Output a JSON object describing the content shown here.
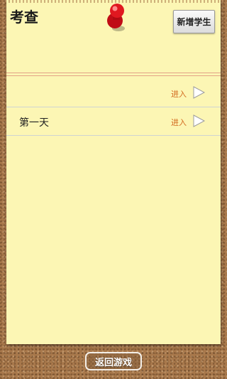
{
  "header": {
    "title": "考查",
    "add_student_label": "新增学生"
  },
  "list": {
    "rows": [
      {
        "label": "",
        "enter_label": "进入"
      },
      {
        "label": "第一天",
        "enter_label": "进入"
      }
    ]
  },
  "footer": {
    "back_label": "返回游戏"
  },
  "icons": {
    "pin": "push-pin-icon",
    "arrow": "play-arrow-icon"
  },
  "colors": {
    "paper": "#fcf6b4",
    "cork": "#a8784b",
    "enter_text": "#d2691e",
    "pin_red": "#d0101a",
    "header_rule": "#e3a386"
  }
}
